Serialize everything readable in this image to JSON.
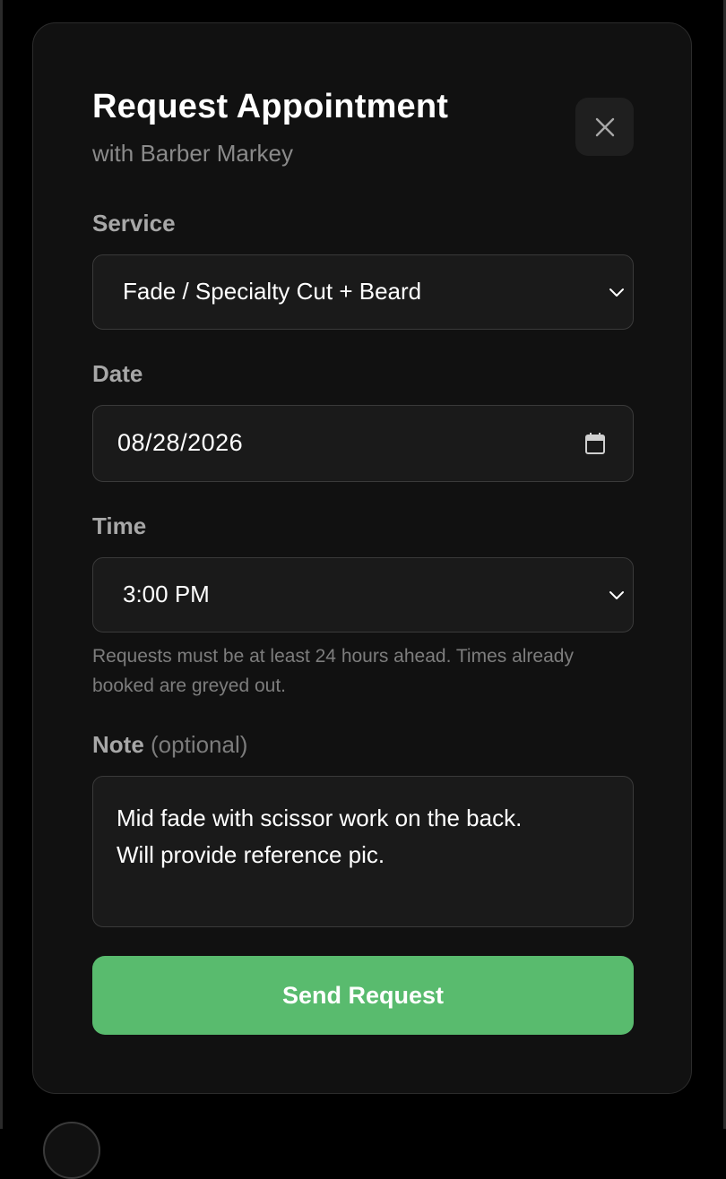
{
  "modal": {
    "title": "Request Appointment",
    "subtitle": "with Barber Markey",
    "close_icon": "close-icon"
  },
  "form": {
    "service": {
      "label": "Service",
      "value": "Fade / Specialty Cut + Beard",
      "icon": "chevron-down-icon"
    },
    "date": {
      "label": "Date",
      "value": "08/28/2026",
      "icon": "calendar-icon"
    },
    "time": {
      "label": "Time",
      "value": "3:00 PM",
      "icon": "chevron-down-icon",
      "help": "Requests must be at least 24 hours ahead. Times already booked are greyed out."
    },
    "note": {
      "label": "Note",
      "optional": "(optional)",
      "value": "Mid fade with scissor work on the back.\nWill provide reference pic."
    },
    "submit_label": "Send Request"
  },
  "colors": {
    "background": "#000000",
    "modal_bg": "#111111",
    "field_bg": "#1a1a1a",
    "accent": "#59bb6e"
  }
}
